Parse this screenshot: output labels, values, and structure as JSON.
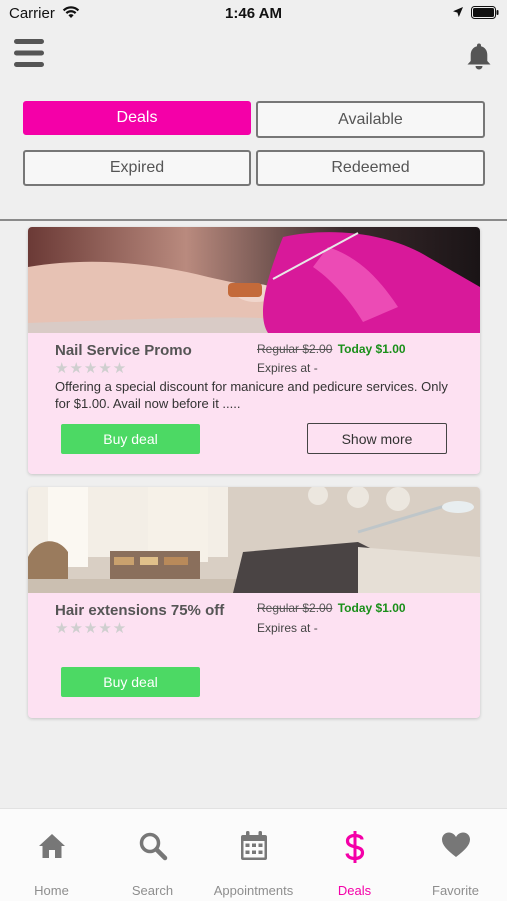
{
  "status_bar": {
    "carrier": "Carrier",
    "time": "1:46 AM"
  },
  "icons": {
    "menu": "hamburger-menu-icon",
    "notifications": "bell-icon"
  },
  "filters": [
    {
      "label": "Deals",
      "active": true
    },
    {
      "label": "Available",
      "active": false
    },
    {
      "label": "Expired",
      "active": false
    },
    {
      "label": "Redeemed",
      "active": false
    }
  ],
  "deals": [
    {
      "title": "Nail Service Promo",
      "rating": 0,
      "stars": "★★★★★",
      "regular_price": "Regular $2.00",
      "today_price": "Today $1.00",
      "expires": "Expires at -",
      "description": "Offering a special discount for manicure and pedicure services. Only for $1.00. Avail now before it  .....",
      "buy_label": "Buy deal",
      "more_label": "Show more"
    },
    {
      "title": "Hair extensions 75% off",
      "rating": 0,
      "stars": "★★★★★",
      "regular_price": "Regular $2.00",
      "today_price": "Today $1.00",
      "expires": "Expires at -",
      "buy_label": "Buy deal"
    }
  ],
  "tabs": [
    {
      "label": "Home",
      "icon": "home-icon"
    },
    {
      "label": "Search",
      "icon": "search-icon"
    },
    {
      "label": "Appointments",
      "icon": "calendar-icon"
    },
    {
      "label": "Deals",
      "icon": "dollar-icon",
      "active": true
    },
    {
      "label": "Favorite",
      "icon": "heart-icon"
    }
  ],
  "colors": {
    "accent": "#f400a8",
    "card_bg": "#fde1f2",
    "buy_button": "#4cd964",
    "today_price": "#1a8f1a"
  }
}
